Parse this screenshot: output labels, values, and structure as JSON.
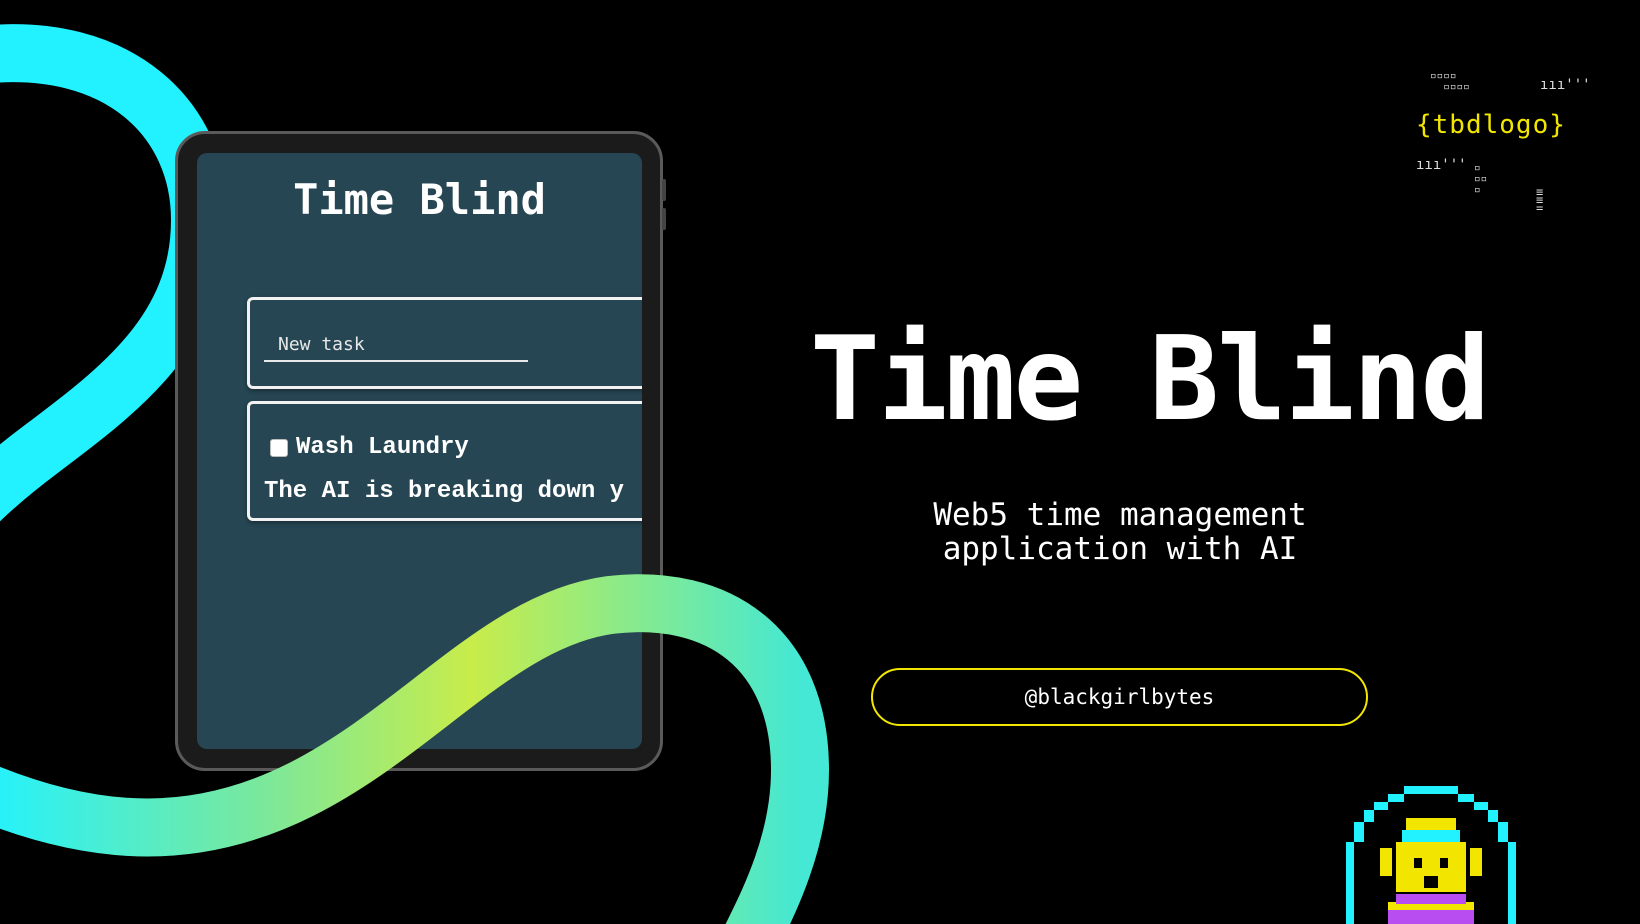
{
  "tablet": {
    "app_title": "Time Blind",
    "task_input": {
      "placeholder": "New task",
      "value": ""
    },
    "task": {
      "label": "Wash Laundry",
      "checked": false,
      "ai_status": "The AI is breaking down y"
    }
  },
  "hero": {
    "title": "Time Blind",
    "subtitle_line1": "Web5 time management",
    "subtitle_line2": "application with AI"
  },
  "handle": "@blackgirlbytes",
  "logo": {
    "text": "{tbdlogo}"
  },
  "colors": {
    "background": "#000000",
    "screen": "#264653",
    "accent_yellow": "#f2e600",
    "ribbon_cyan": "#22f2ff",
    "ribbon_lime": "#c8ec4a"
  },
  "icons": [
    "checkbox-icon",
    "pixel-avatar-icon",
    "tbd-logo-glitch-icon"
  ]
}
